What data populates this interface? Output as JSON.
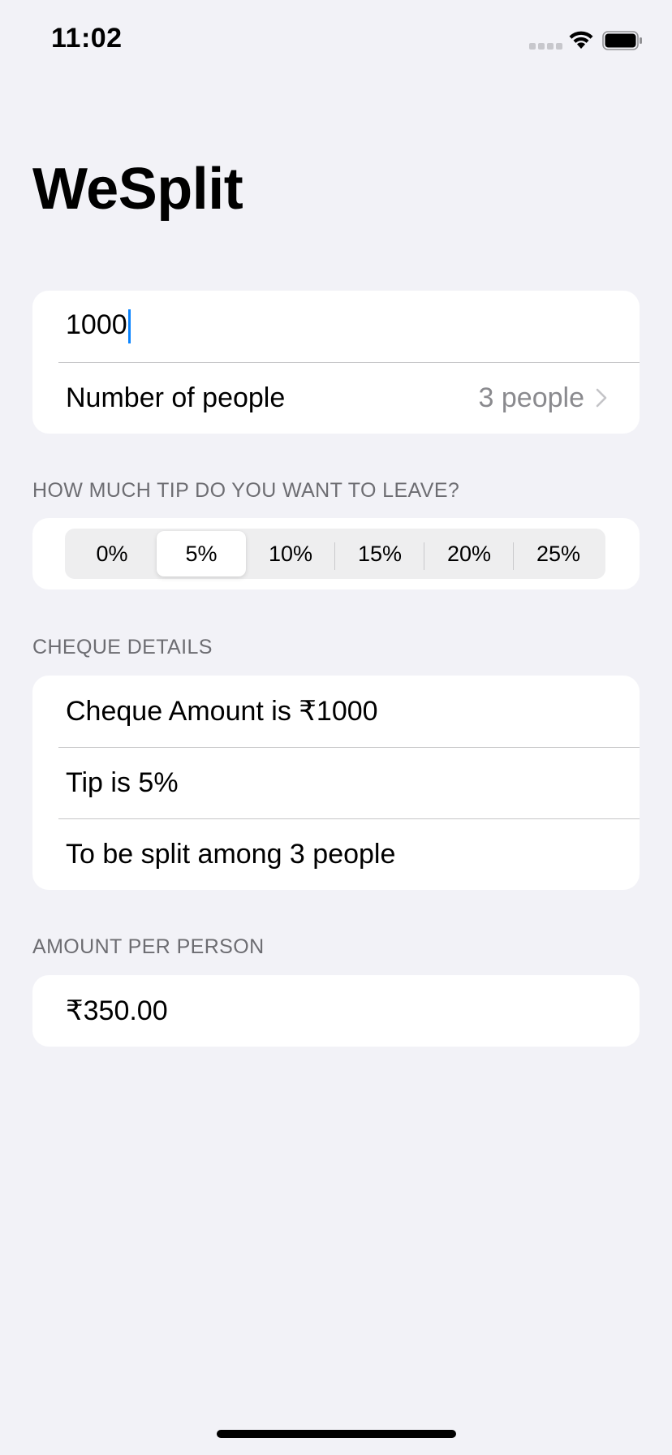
{
  "status_bar": {
    "time": "11:02"
  },
  "nav": {
    "title": "WeSplit"
  },
  "input_section": {
    "amount_value": "1000",
    "people_label": "Number of people",
    "people_value": "3 people"
  },
  "tip_section": {
    "header": "HOW MUCH TIP DO YOU WANT TO LEAVE?",
    "options": [
      "0%",
      "5%",
      "10%",
      "15%",
      "20%",
      "25%"
    ],
    "selected": "5%"
  },
  "cheque_section": {
    "header": "CHEQUE DETAILS",
    "rows": [
      "Cheque Amount is ₹1000",
      "Tip is 5%",
      "To be split among 3 people"
    ]
  },
  "per_person_section": {
    "header": "AMOUNT PER PERSON",
    "value": "₹350.00"
  },
  "colors": {
    "background": "#f2f2f7",
    "accent": "#0a84ff",
    "secondary_text": "#8a8a8e"
  }
}
